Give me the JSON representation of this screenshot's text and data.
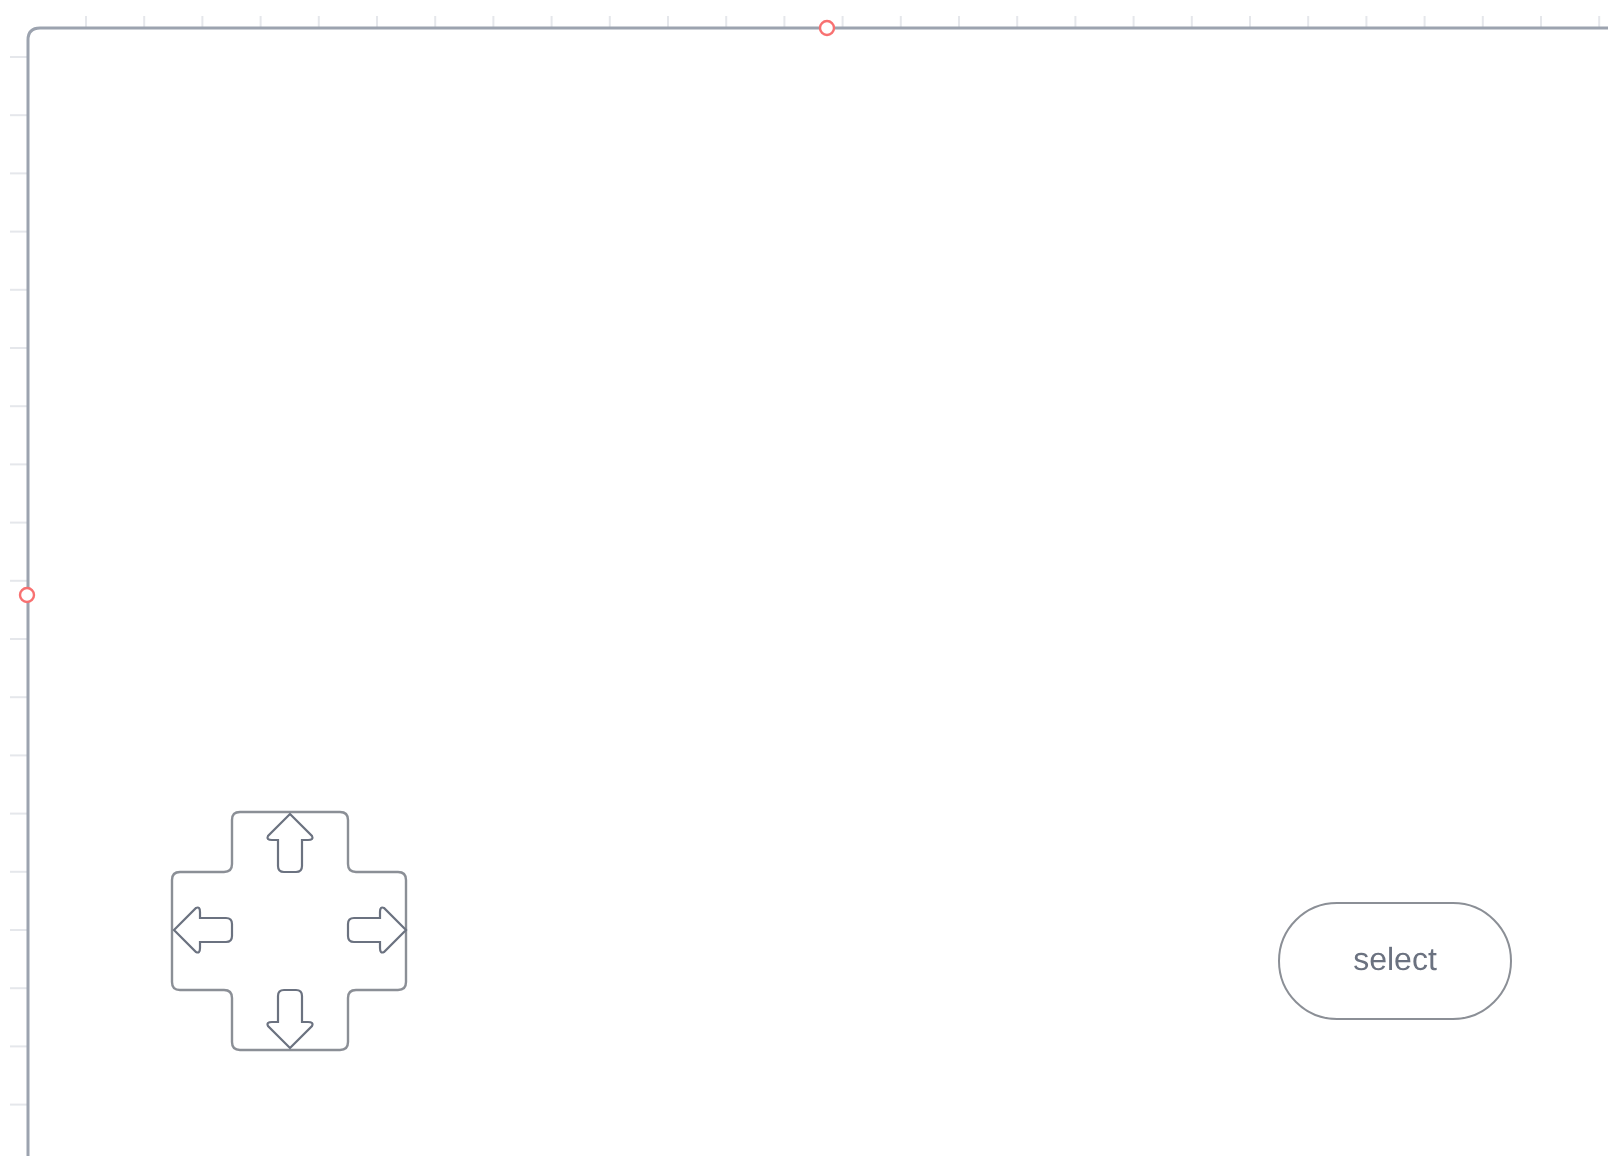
{
  "button": {
    "label": "select"
  }
}
